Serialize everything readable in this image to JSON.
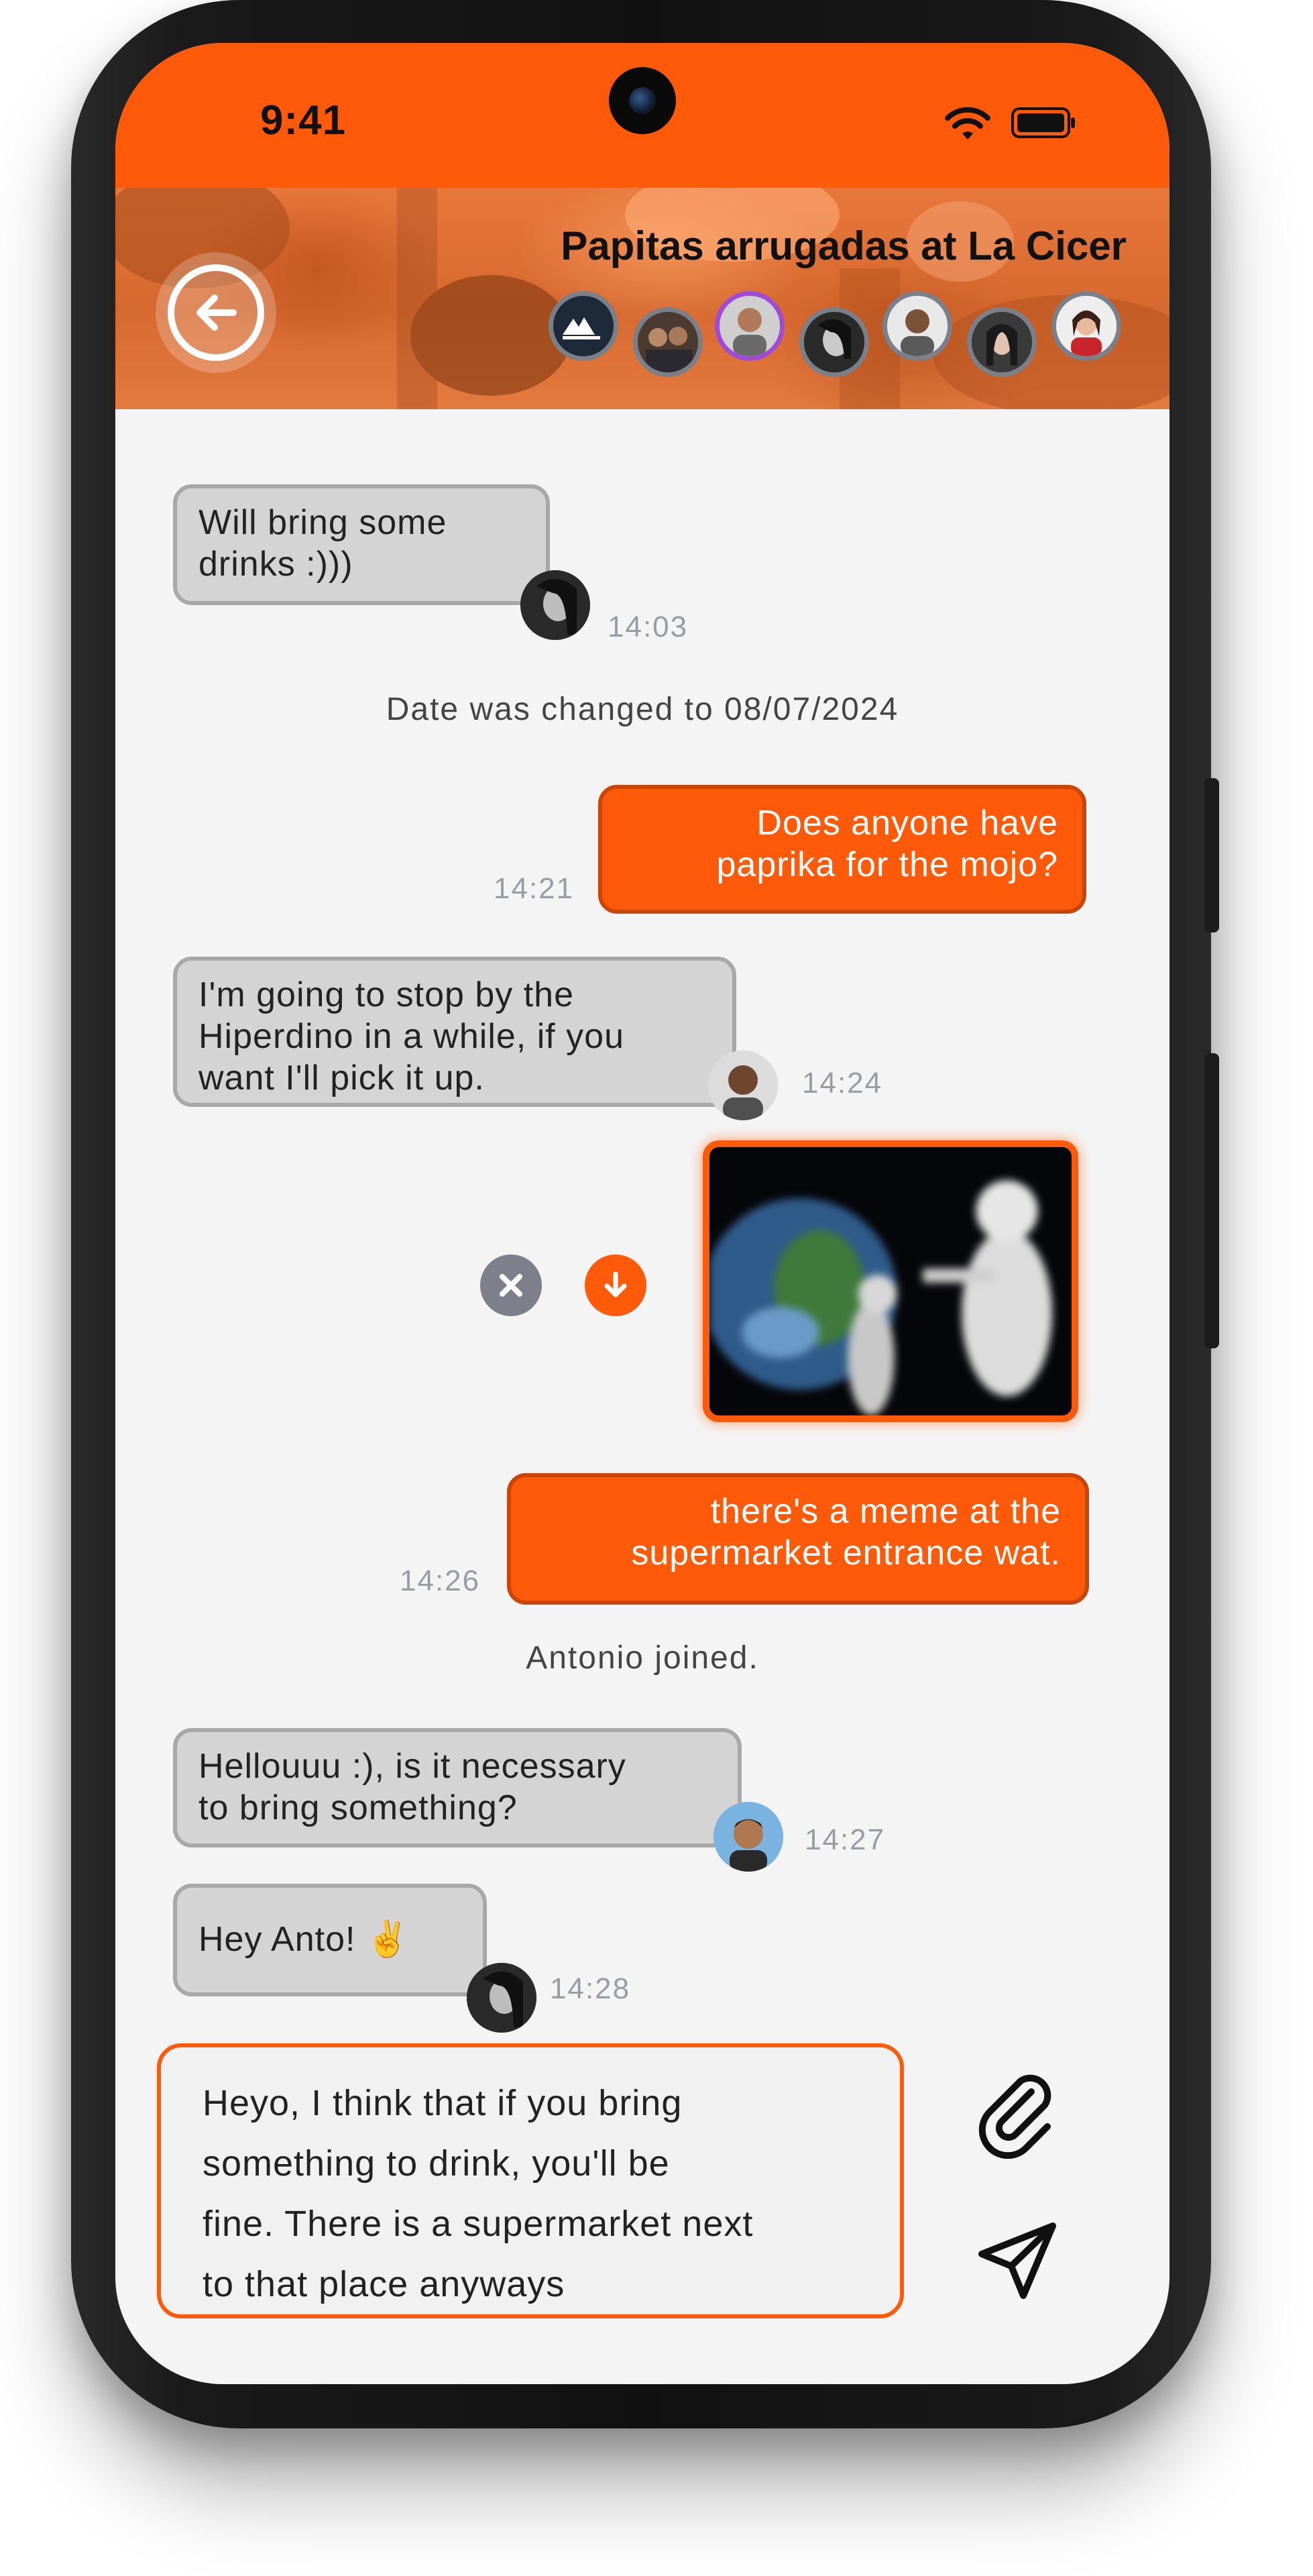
{
  "status_bar": {
    "time": "9:41"
  },
  "header": {
    "title": "Papitas arrugadas at La Cicer",
    "back_icon": "arrow-left-circle-icon",
    "participants_count_shown": 7
  },
  "messages": [
    {
      "kind": "incoming",
      "text_lines": [
        "Will bring some",
        "drinks :)))"
      ],
      "time": "14:03"
    },
    {
      "kind": "system",
      "text": "Date was changed to 08/07/2024"
    },
    {
      "kind": "outgoing",
      "text_lines": [
        "Does anyone have",
        "paprika for the mojo?"
      ],
      "time": "14:21"
    },
    {
      "kind": "incoming",
      "text_lines": [
        "I'm going to stop by the",
        "Hiperdino in a while, if you",
        "want I'll pick it up."
      ],
      "time": "14:24"
    },
    {
      "kind": "outgoing-image",
      "cancel_icon": "close-icon",
      "download_icon": "download-arrow-icon"
    },
    {
      "kind": "outgoing",
      "text_lines": [
        "there's a meme at the",
        "supermarket  entrance wat."
      ],
      "time": "14:26"
    },
    {
      "kind": "system",
      "text": "Antonio joined."
    },
    {
      "kind": "incoming",
      "text_lines": [
        "Hellouuu :), is it necessary",
        "to bring something?"
      ],
      "time": "14:27"
    },
    {
      "kind": "incoming",
      "text_lines": [
        "Hey Anto! ✌️"
      ],
      "time": "14:28"
    }
  ],
  "composer": {
    "text_lines": [
      "Heyo, I think that if you bring",
      "something to drink, you'll be",
      "fine. There is a supermarket next",
      "to that place anyways"
    ],
    "attach_icon": "paperclip-icon",
    "send_icon": "send-icon"
  },
  "colors": {
    "accent": "#ff5a0a",
    "accent_dark": "#c94607",
    "incoming_bubble": "#d4d4d4",
    "incoming_border": "#a8a8a8",
    "timestamp": "#9a9ca3",
    "chat_background": "#f4f4f4"
  }
}
